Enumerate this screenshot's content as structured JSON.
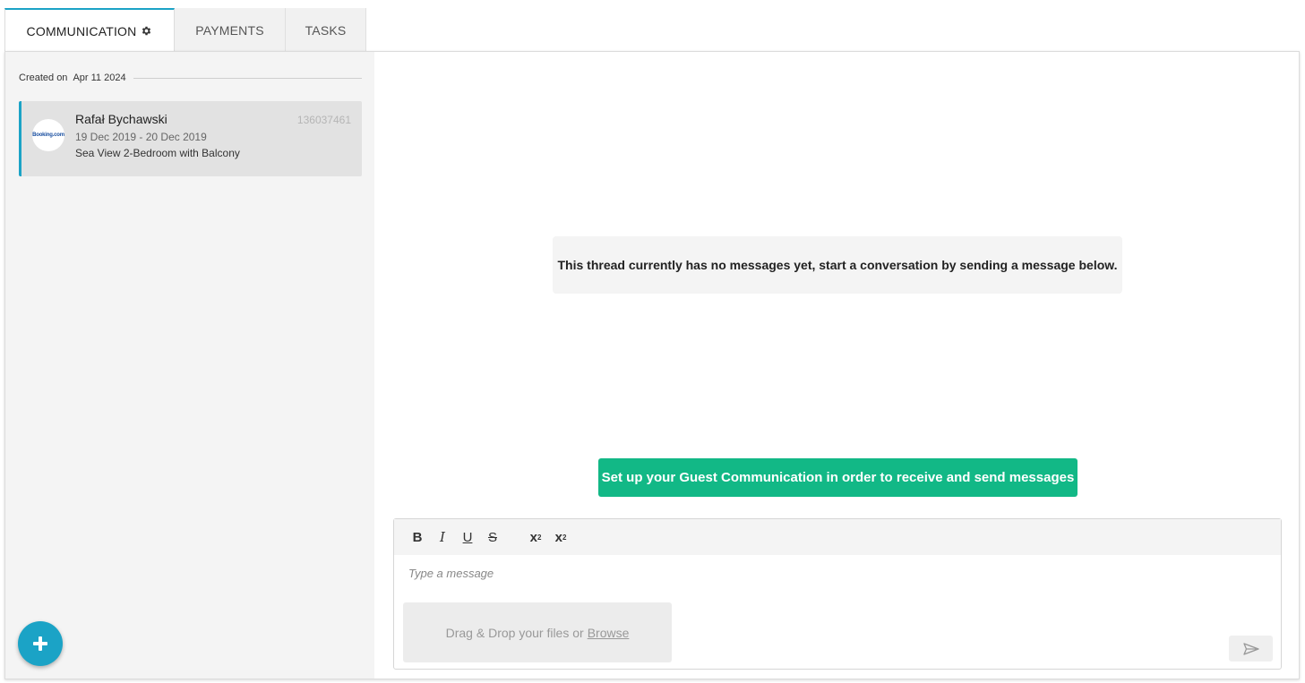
{
  "tabs": [
    {
      "label": "COMMUNICATION"
    },
    {
      "label": "PAYMENTS"
    },
    {
      "label": "TASKS"
    }
  ],
  "sidebar": {
    "created_label": "Created on",
    "created_date": "Apr 11 2024",
    "thread": {
      "guest_name": "Rafał Bychawski",
      "reservation_id": "136037461",
      "dates": "19 Dec 2019 - 20 Dec 2019",
      "room": "Sea View 2-Bedroom with Balcony",
      "channel_logo_text": "Booking.com"
    }
  },
  "content": {
    "empty_message": "This thread currently has no messages yet, start a conversation by sending a message below.",
    "setup_button": "Set up your Guest Communication in order to receive and send messages",
    "editor": {
      "placeholder": "Type a message",
      "toolbar": {
        "bold": "B",
        "italic": "I",
        "underline": "U",
        "strike": "S",
        "subscript": "x",
        "subscript_mark": "2",
        "superscript": "x",
        "superscript_mark": "2"
      },
      "dropzone_text": "Drag & Drop your files or",
      "browse_link": "Browse"
    }
  },
  "colors": {
    "accent": "#1ba3c6",
    "success": "#12b886"
  },
  "icons": {
    "settings": "gear-icon",
    "add": "plus-icon",
    "send": "send-icon"
  }
}
